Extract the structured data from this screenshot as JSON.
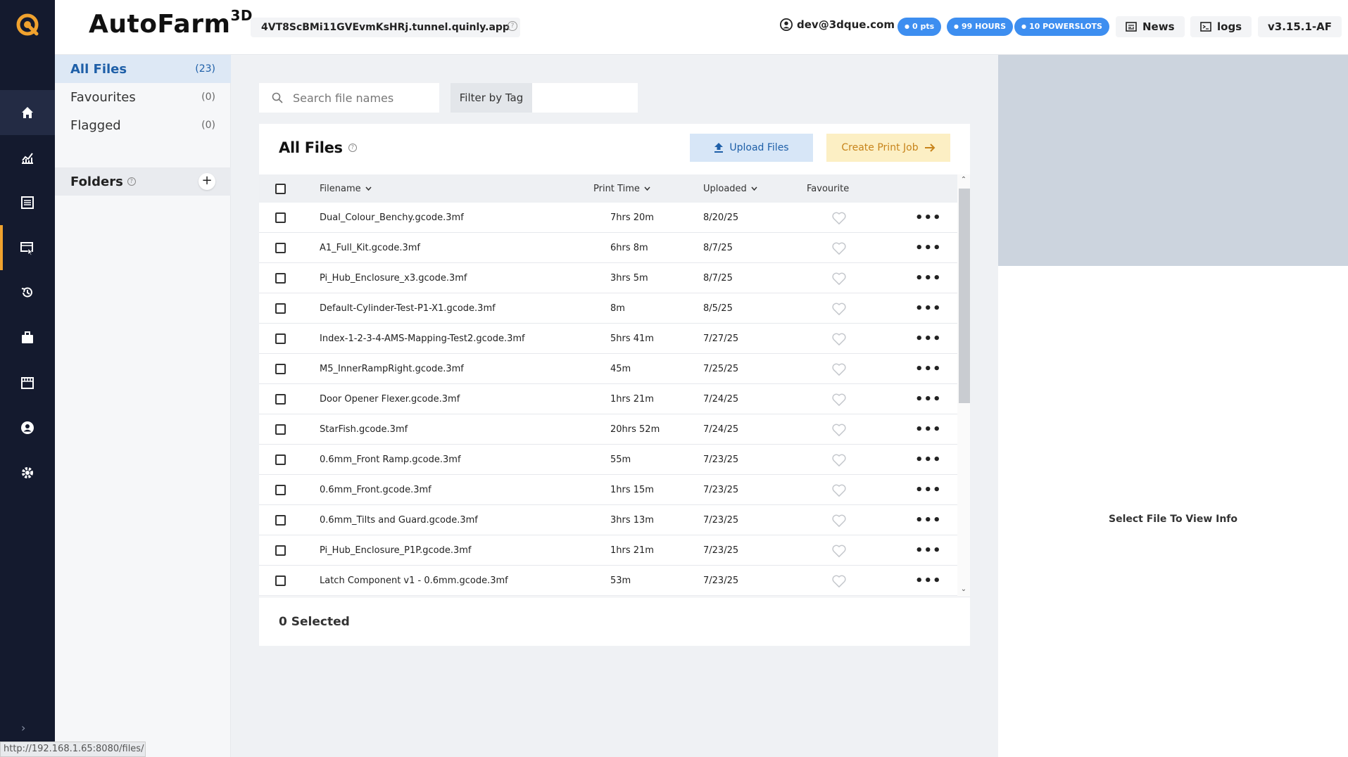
{
  "app": {
    "brand": "AutoFarm",
    "brand_sup": "3D",
    "tunnel": "4VT8ScBMi11GVEvmKsHRj.tunnel.quinly.app",
    "user_email": "dev@3dque.com",
    "pills": [
      "0 pts",
      "99 HOURS",
      "10 POWERSLOTS"
    ],
    "news_label": "News",
    "logs_label": "logs",
    "version": "v3.15.1-AF",
    "accent": "#f0a22e",
    "pill_color": "#3d8ef0"
  },
  "sidebar_icons": [
    "home-icon",
    "analytics-icon",
    "list-icon",
    "files-icon",
    "history-icon",
    "briefcase-icon",
    "store-icon",
    "user-icon",
    "gear-icon"
  ],
  "filters": {
    "items": [
      {
        "label": "All Files",
        "count": "(23)"
      },
      {
        "label": "Favourites",
        "count": "(0)"
      },
      {
        "label": "Flagged",
        "count": "(0)"
      }
    ],
    "folders_label": "Folders",
    "folders_add": "+"
  },
  "main": {
    "search_placeholder": "Search file names",
    "tag_label": "Filter by Tag",
    "card_title": "All Files",
    "upload_label": "Upload Files",
    "create_label": "Create Print Job",
    "columns": {
      "filename": "Filename",
      "print_time": "Print Time",
      "uploaded": "Uploaded",
      "favourite": "Favourite"
    },
    "rows": [
      {
        "filename": "Dual_Colour_Benchy.gcode.3mf",
        "print_time": "7hrs 20m",
        "uploaded": "8/20/25"
      },
      {
        "filename": "A1_Full_Kit.gcode.3mf",
        "print_time": "6hrs 8m",
        "uploaded": "8/7/25"
      },
      {
        "filename": "Pi_Hub_Enclosure_x3.gcode.3mf",
        "print_time": "3hrs 5m",
        "uploaded": "8/7/25"
      },
      {
        "filename": "Default-Cylinder-Test-P1-X1.gcode.3mf",
        "print_time": "8m",
        "uploaded": "8/5/25"
      },
      {
        "filename": "Index-1-2-3-4-AMS-Mapping-Test2.gcode.3mf",
        "print_time": "5hrs 41m",
        "uploaded": "7/27/25"
      },
      {
        "filename": "M5_InnerRampRight.gcode.3mf",
        "print_time": "45m",
        "uploaded": "7/25/25"
      },
      {
        "filename": "Door Opener Flexer.gcode.3mf",
        "print_time": "1hrs 21m",
        "uploaded": "7/24/25"
      },
      {
        "filename": "StarFish.gcode.3mf",
        "print_time": "20hrs 52m",
        "uploaded": "7/24/25"
      },
      {
        "filename": "0.6mm_Front Ramp.gcode.3mf",
        "print_time": "55m",
        "uploaded": "7/23/25"
      },
      {
        "filename": "0.6mm_Front.gcode.3mf",
        "print_time": "1hrs 15m",
        "uploaded": "7/23/25"
      },
      {
        "filename": "0.6mm_Tilts and Guard.gcode.3mf",
        "print_time": "3hrs 13m",
        "uploaded": "7/23/25"
      },
      {
        "filename": "Pi_Hub_Enclosure_P1P.gcode.3mf",
        "print_time": "1hrs 21m",
        "uploaded": "7/23/25"
      },
      {
        "filename": "Latch Component v1 - 0.6mm.gcode.3mf",
        "print_time": "53m",
        "uploaded": "7/23/25"
      }
    ],
    "selected_text": "0 Selected"
  },
  "info": {
    "placeholder": "Select File To View Info"
  },
  "statusbar": "http://192.168.1.65:8080/files/"
}
